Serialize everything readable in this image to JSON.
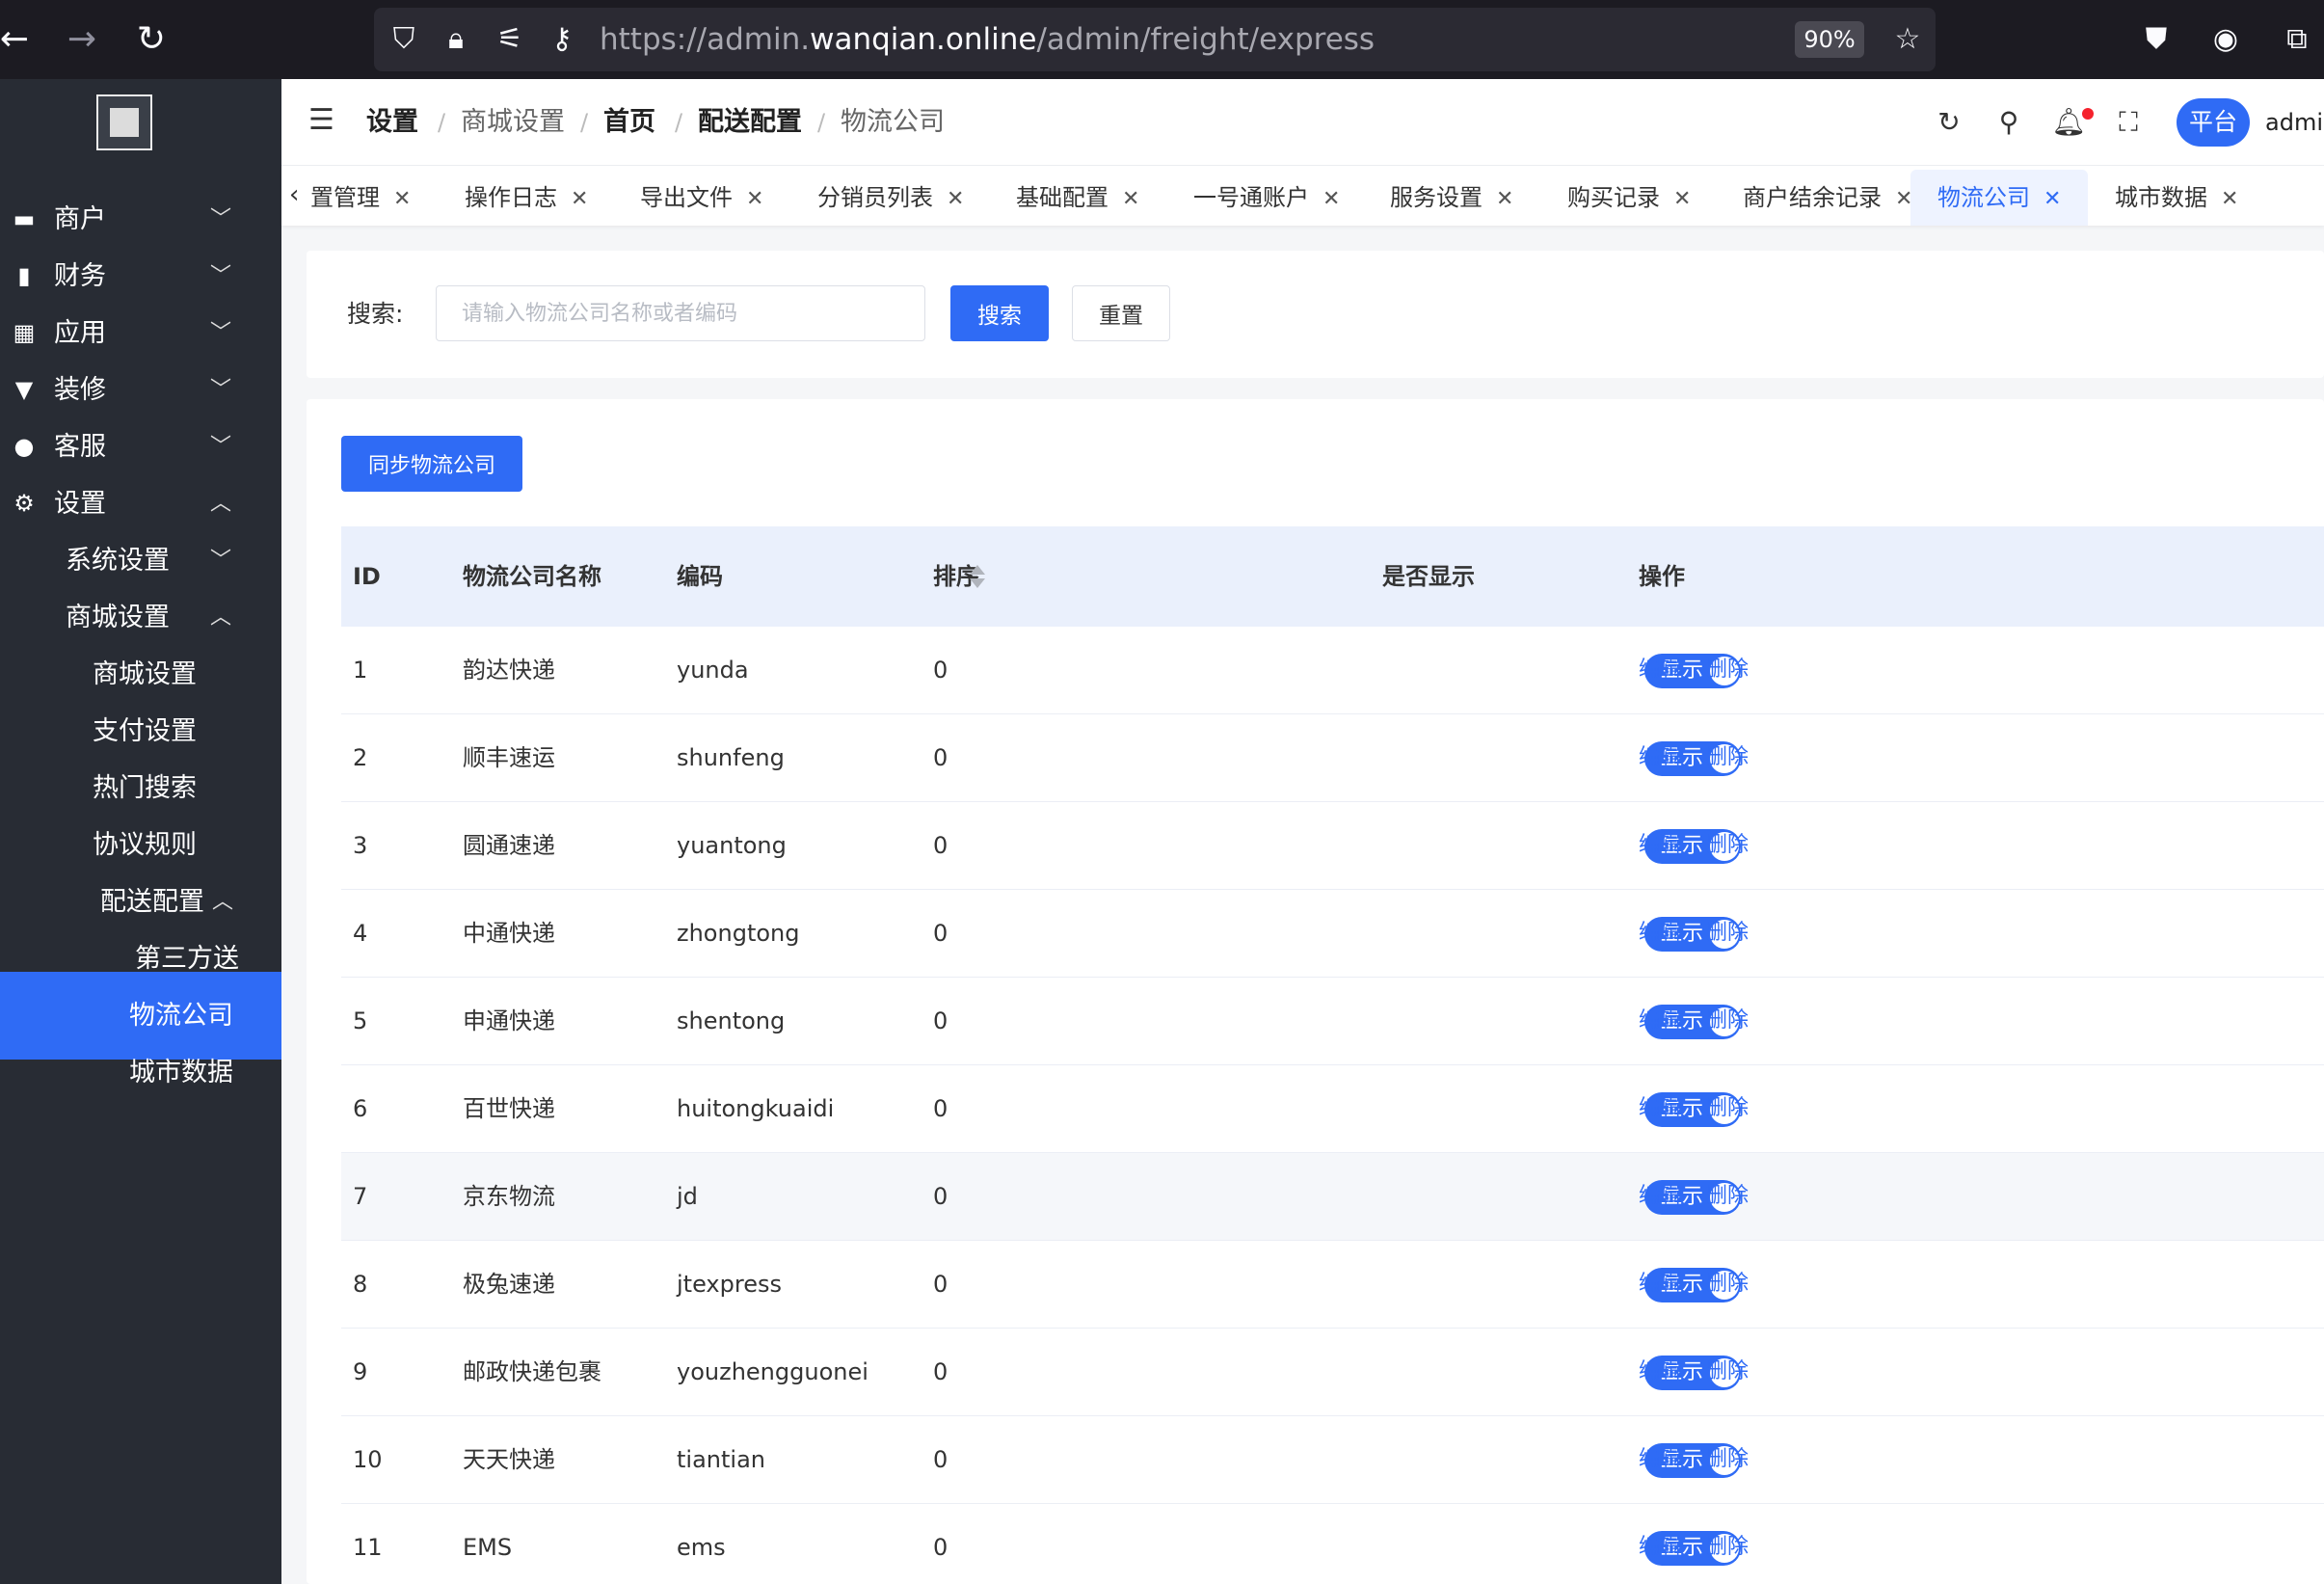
{
  "browser": {
    "url_prefix": "https://admin.",
    "url_domain": "wanqian.online",
    "url_path": "/admin/freight/express",
    "zoom": "90%",
    "icons": [
      "back-arrow-icon",
      "forward-arrow-icon",
      "reload-icon",
      "shield-icon",
      "lock-icon",
      "permissions-icon",
      "key-icon",
      "star-icon",
      "pocket-icon",
      "account-icon",
      "extensions-icon"
    ]
  },
  "sidebar": {
    "items": [
      {
        "label": "商户",
        "icon": "store-icon",
        "chevron": "down"
      },
      {
        "label": "财务",
        "icon": "bar-chart-icon",
        "chevron": "down"
      },
      {
        "label": "应用",
        "icon": "grid-icon",
        "chevron": "down"
      },
      {
        "label": "装修",
        "icon": "brush-icon",
        "chevron": "down"
      },
      {
        "label": "客服",
        "icon": "user-icon",
        "chevron": "down"
      },
      {
        "label": "设置",
        "icon": "gear-icon",
        "chevron": "up"
      },
      {
        "label": "系统设置",
        "chevron": "down"
      },
      {
        "label": "商城设置",
        "chevron": "up"
      },
      {
        "label": "商城设置"
      },
      {
        "label": "支付设置"
      },
      {
        "label": "热门搜索"
      },
      {
        "label": "协议规则"
      },
      {
        "label": "配送配置",
        "chevron": "up"
      },
      {
        "label": "第三方送"
      },
      {
        "label": "物流公司",
        "active": true
      },
      {
        "label": "城市数据"
      }
    ]
  },
  "header": {
    "breadcrumbs": [
      "设置",
      "商城设置",
      "首页",
      "配送配置",
      "物流公司"
    ],
    "platform_label": "平台",
    "user_name": "admin"
  },
  "tabs": [
    {
      "label": "置管理"
    },
    {
      "label": "操作日志"
    },
    {
      "label": "导出文件"
    },
    {
      "label": "分销员列表"
    },
    {
      "label": "基础配置"
    },
    {
      "label": "一号通账户"
    },
    {
      "label": "服务设置"
    },
    {
      "label": "购买记录"
    },
    {
      "label": "商户结余记录"
    },
    {
      "label": "物流公司",
      "active": true
    },
    {
      "label": "城市数据"
    }
  ],
  "search": {
    "label": "搜索:",
    "placeholder": "请输入物流公司名称或者编码",
    "value": "",
    "search_label": "搜索",
    "reset_label": "重置"
  },
  "table": {
    "sync_label": "同步物流公司",
    "columns": [
      "ID",
      "物流公司名称",
      "编码",
      "排序",
      "是否显示",
      "操作"
    ],
    "switch_label": "显示",
    "edit_label": "编辑",
    "delete_label": "删除",
    "rows": [
      {
        "id": "1",
        "name": "韵达快递",
        "code": "yunda",
        "sort": "0",
        "shown": true
      },
      {
        "id": "2",
        "name": "顺丰速运",
        "code": "shunfeng",
        "sort": "0",
        "shown": true
      },
      {
        "id": "3",
        "name": "圆通速递",
        "code": "yuantong",
        "sort": "0",
        "shown": true
      },
      {
        "id": "4",
        "name": "中通快递",
        "code": "zhongtong",
        "sort": "0",
        "shown": true
      },
      {
        "id": "5",
        "name": "申通快递",
        "code": "shentong",
        "sort": "0",
        "shown": true
      },
      {
        "id": "6",
        "name": "百世快递",
        "code": "huitongkuaidi",
        "sort": "0",
        "shown": true
      },
      {
        "id": "7",
        "name": "京东物流",
        "code": "jd",
        "sort": "0",
        "shown": true,
        "hover": true
      },
      {
        "id": "8",
        "name": "极兔速递",
        "code": "jtexpress",
        "sort": "0",
        "shown": true
      },
      {
        "id": "9",
        "name": "邮政快递包裹",
        "code": "youzhengguonei",
        "sort": "0",
        "shown": true
      },
      {
        "id": "10",
        "name": "天天快递",
        "code": "tiantian",
        "sort": "0",
        "shown": true
      },
      {
        "id": "11",
        "name": "EMS",
        "code": "ems",
        "sort": "0",
        "shown": true
      }
    ]
  },
  "colors": {
    "accent": "#2f6bf5",
    "sidebar_bg": "#282c34",
    "header_bg": "#eaf0fc"
  }
}
